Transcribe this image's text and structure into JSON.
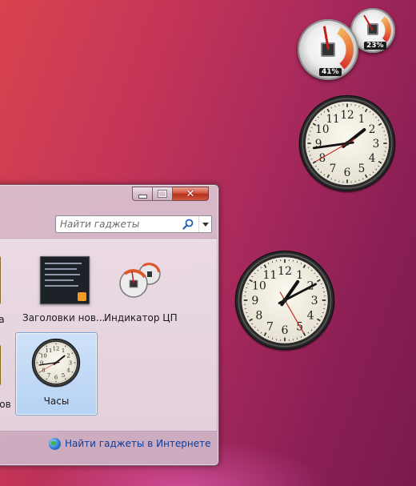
{
  "desktop": {
    "cpu_meter": {
      "cpu_percent": "41%",
      "memory_percent": "23%",
      "cpu_value": 41,
      "memory_value": 23
    },
    "clock_1": {
      "hour": 1,
      "minute": 43,
      "second": 40
    },
    "clock_2": {
      "hour": 1,
      "minute": 10,
      "second": 25
    }
  },
  "gallery": {
    "search": {
      "placeholder": "Найти гаджеты"
    },
    "tiles": [
      {
        "label": "ка"
      },
      {
        "label": "дов"
      },
      {
        "label": "Заголовки нов..."
      },
      {
        "label": "Индикатор ЦП"
      },
      {
        "label": "Часы"
      }
    ],
    "footer_link": "Найти гаджеты в Интернете"
  },
  "colors": {
    "close_button": "#c7402a",
    "selected_tile": "#cde2fa",
    "link": "#0b3c9e"
  }
}
